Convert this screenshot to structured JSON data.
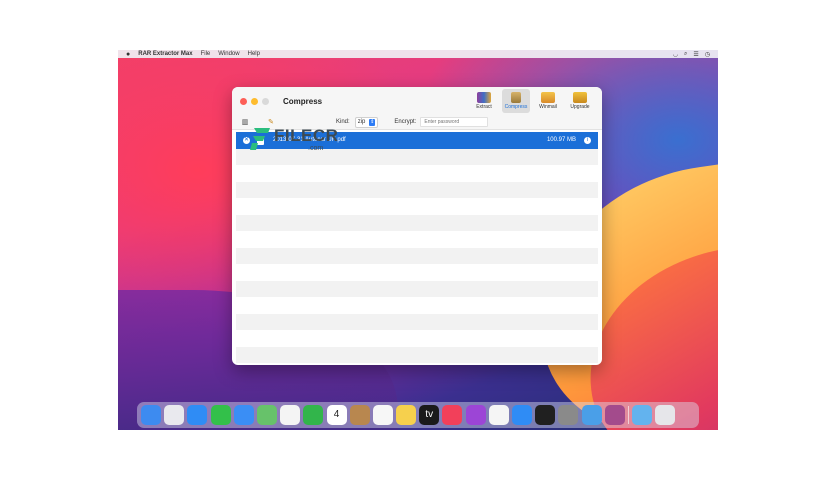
{
  "menubar": {
    "app_name": "RAR Extractor Max",
    "items": [
      "File",
      "Window",
      "Help"
    ]
  },
  "window": {
    "title": "Compress",
    "toolbar": {
      "extract_label": "Extract",
      "compress_label": "Compress",
      "winmail_label": "Winmail",
      "upgrade_label": "Upgrade",
      "active": "Compress"
    },
    "options": {
      "kind_label": "Kind:",
      "kind_value": "zip",
      "encrypt_label": "Encrypt:",
      "password_placeholder": "Enter password"
    },
    "files": [
      {
        "name": "2013-07-31 Autocar UK.pdf",
        "size": "100.97 MB"
      }
    ]
  },
  "watermark": {
    "brand": "FILECR",
    "domain": ".com"
  },
  "dock": {
    "apps": [
      {
        "icon": "finder-icon",
        "color": "#3d8bf0"
      },
      {
        "icon": "launchpad-icon",
        "color": "#e9e9ee"
      },
      {
        "icon": "safari-icon",
        "color": "#2f8cf5"
      },
      {
        "icon": "messages-icon",
        "color": "#33c04a"
      },
      {
        "icon": "mail-icon",
        "color": "#3a8ef5"
      },
      {
        "icon": "maps-icon",
        "color": "#67c26a"
      },
      {
        "icon": "photos-icon",
        "color": "#f4f4f4"
      },
      {
        "icon": "facetime-icon",
        "color": "#32b54b"
      },
      {
        "icon": "calendar-icon",
        "color": "#ffffff",
        "label": "4"
      },
      {
        "icon": "contacts-icon",
        "color": "#b8874f"
      },
      {
        "icon": "reminders-icon",
        "color": "#f7f7f7"
      },
      {
        "icon": "notes-icon",
        "color": "#f6d04d"
      },
      {
        "icon": "appletv-icon",
        "color": "#1a1a1a",
        "label": "tv"
      },
      {
        "icon": "music-icon",
        "color": "#f2405a"
      },
      {
        "icon": "podcasts-icon",
        "color": "#9c45d6"
      },
      {
        "icon": "news-icon",
        "color": "#f5f5f5"
      },
      {
        "icon": "appstore-icon",
        "color": "#2f8cf5"
      },
      {
        "icon": "terminal-icon",
        "color": "#202020"
      },
      {
        "icon": "systempreferences-icon",
        "color": "#8a8a8a"
      },
      {
        "icon": "altimeter-icon",
        "color": "#4a9fe8"
      },
      {
        "icon": "rar-extractor-icon",
        "color": "#a34b8c"
      }
    ],
    "extras": [
      {
        "icon": "downloads-folder-icon",
        "color": "#63b3ee"
      },
      {
        "icon": "trash-icon",
        "color": "#e6e6ea"
      }
    ]
  }
}
